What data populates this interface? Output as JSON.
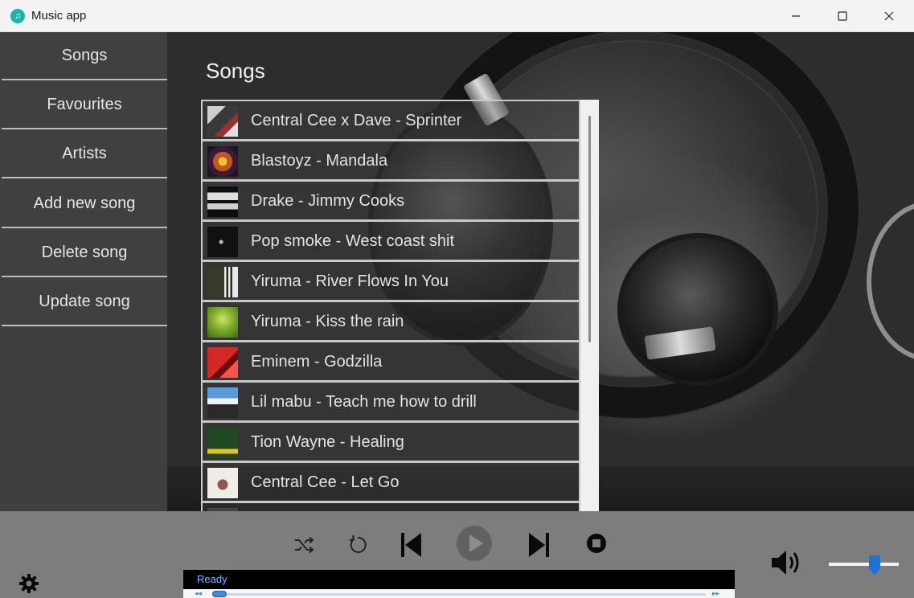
{
  "window": {
    "title": "Music app",
    "icon": "music-note-icon",
    "controls": [
      "minimize",
      "maximize",
      "close"
    ]
  },
  "sidebar": {
    "items": [
      {
        "label": "Songs"
      },
      {
        "label": "Favourites"
      },
      {
        "label": "Artists"
      },
      {
        "label": "Add new song"
      },
      {
        "label": "Delete song"
      },
      {
        "label": "Update song"
      }
    ]
  },
  "main": {
    "title": "Songs",
    "songs": [
      {
        "title": "Central Cee x Dave - Sprinter",
        "thumb_color": "#8a8a8a"
      },
      {
        "title": "Blastoyz - Mandala",
        "thumb_color": "#c0581c"
      },
      {
        "title": "Drake - Jimmy Cooks",
        "thumb_color": "#202020"
      },
      {
        "title": "Pop smoke - West coast shit",
        "thumb_color": "#111111"
      },
      {
        "title": "Yiruma - River Flows In You",
        "thumb_color": "#6c6a5a"
      },
      {
        "title": "Yiruma - Kiss the rain",
        "thumb_color": "#7fae2a"
      },
      {
        "title": "Eminem - Godzilla",
        "thumb_color": "#b01818"
      },
      {
        "title": "Lil mabu - Teach me how to drill",
        "thumb_color": "#3f86c8"
      },
      {
        "title": "Tion Wayne - Healing",
        "thumb_color": "#2f5a2a"
      },
      {
        "title": "Central Cee - Let Go",
        "thumb_color": "#e4e0dc"
      }
    ]
  },
  "player": {
    "controls": [
      "shuffle",
      "repeat",
      "previous",
      "play",
      "next",
      "stop"
    ],
    "status": "Ready",
    "seek_position": 0.0,
    "volume": 0.62,
    "accent_color": "#3b8ce0"
  }
}
